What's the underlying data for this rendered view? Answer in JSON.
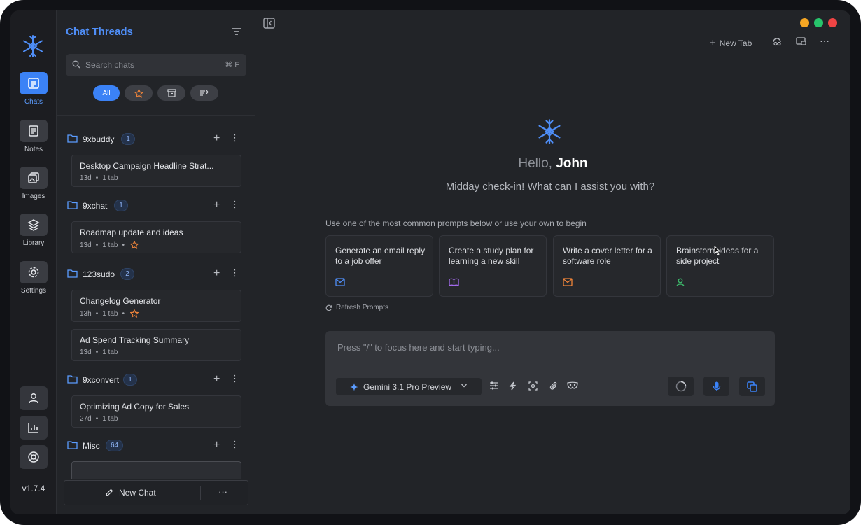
{
  "rail": {
    "grip": ":::",
    "items": [
      {
        "label": "Chats"
      },
      {
        "label": "Notes"
      },
      {
        "label": "Images"
      },
      {
        "label": "Library"
      },
      {
        "label": "Settings"
      }
    ],
    "version": "v1.7.4"
  },
  "threads": {
    "title": "Chat Threads",
    "search_placeholder": "Search chats",
    "search_shortcut": "⌘ F",
    "chip_all": "All",
    "folders": [
      {
        "name": "9xbuddy",
        "count": "1",
        "chats": [
          {
            "title": "Desktop Campaign Headline Strat...",
            "age": "13d",
            "tabs": "1 tab",
            "starred": false
          }
        ]
      },
      {
        "name": "9xchat",
        "count": "1",
        "chats": [
          {
            "title": "Roadmap update and ideas",
            "age": "13d",
            "tabs": "1 tab",
            "starred": true
          }
        ]
      },
      {
        "name": "123sudo",
        "count": "2",
        "chats": [
          {
            "title": "Changelog Generator",
            "age": "13h",
            "tabs": "1 tab",
            "starred": true
          },
          {
            "title": "Ad Spend Tracking Summary",
            "age": "13d",
            "tabs": "1 tab",
            "starred": false
          }
        ]
      },
      {
        "name": "9xconvert",
        "count": "1",
        "chats": [
          {
            "title": "Optimizing Ad Copy for Sales",
            "age": "27d",
            "tabs": "1 tab",
            "starred": false
          }
        ]
      },
      {
        "name": "Misc",
        "count": "64",
        "chats": []
      }
    ],
    "new_chat_label": "New Chat",
    "more_label": "···"
  },
  "main": {
    "new_tab_label": "New Tab",
    "greeting": "Hello,",
    "user_name": "John",
    "subtitle": "Midday check-in! What can I assist you with?",
    "hint": "Use one of the most common prompts below or use your own to begin",
    "prompts": [
      {
        "text": "Generate an email reply to a job offer",
        "icon": "mail-icon",
        "color": "#4f8ef7"
      },
      {
        "text": "Create a study plan for learning a new skill",
        "icon": "book-icon",
        "color": "#a66cf0"
      },
      {
        "text": "Write a cover letter for a software role",
        "icon": "mail-icon",
        "color": "#f0843a"
      },
      {
        "text": "Brainstorm ideas for a side project",
        "icon": "person-icon",
        "color": "#3dbb6c"
      }
    ],
    "refresh_label": "Refresh Prompts",
    "composer_placeholder": "Press \"/\" to focus here and start typing...",
    "model_name": "Gemini 3.1 Pro Preview"
  },
  "colors": {
    "accent": "#3b82f6",
    "star": "#f0843a",
    "traffic_yellow": "#f5a623",
    "traffic_green": "#27c46b",
    "traffic_red": "#ef4444"
  }
}
